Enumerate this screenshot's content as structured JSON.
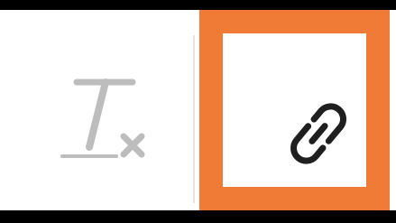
{
  "toolbar": {
    "buttons": [
      {
        "name": "clear-formatting",
        "icon": "clear-format-icon",
        "state": "disabled",
        "icon_color": "#bdbdbd"
      },
      {
        "name": "insert-link",
        "icon": "link-icon",
        "state": "highlighted",
        "icon_color": "#1f1f1f"
      }
    ]
  },
  "highlight": {
    "color": "#ef7b36"
  }
}
